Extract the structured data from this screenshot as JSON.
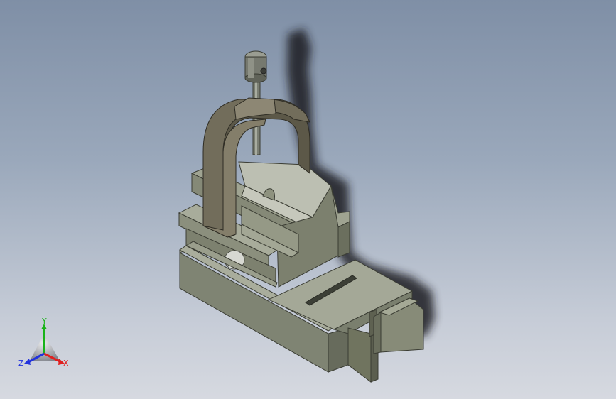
{
  "viewport": {
    "background_top": "#7f8fa6",
    "background_bottom": "#d6d9e0"
  },
  "model": {
    "body_color": "#8d917f",
    "clamp_color": "#6f6a58",
    "slot_color": "#3c3f36",
    "shadow_color": "#1b1d20"
  },
  "triad": {
    "x_label": "X",
    "y_label": "Y",
    "z_label": "Z",
    "x_color": "#e02020",
    "y_color": "#19b319",
    "z_color": "#2233dd"
  }
}
